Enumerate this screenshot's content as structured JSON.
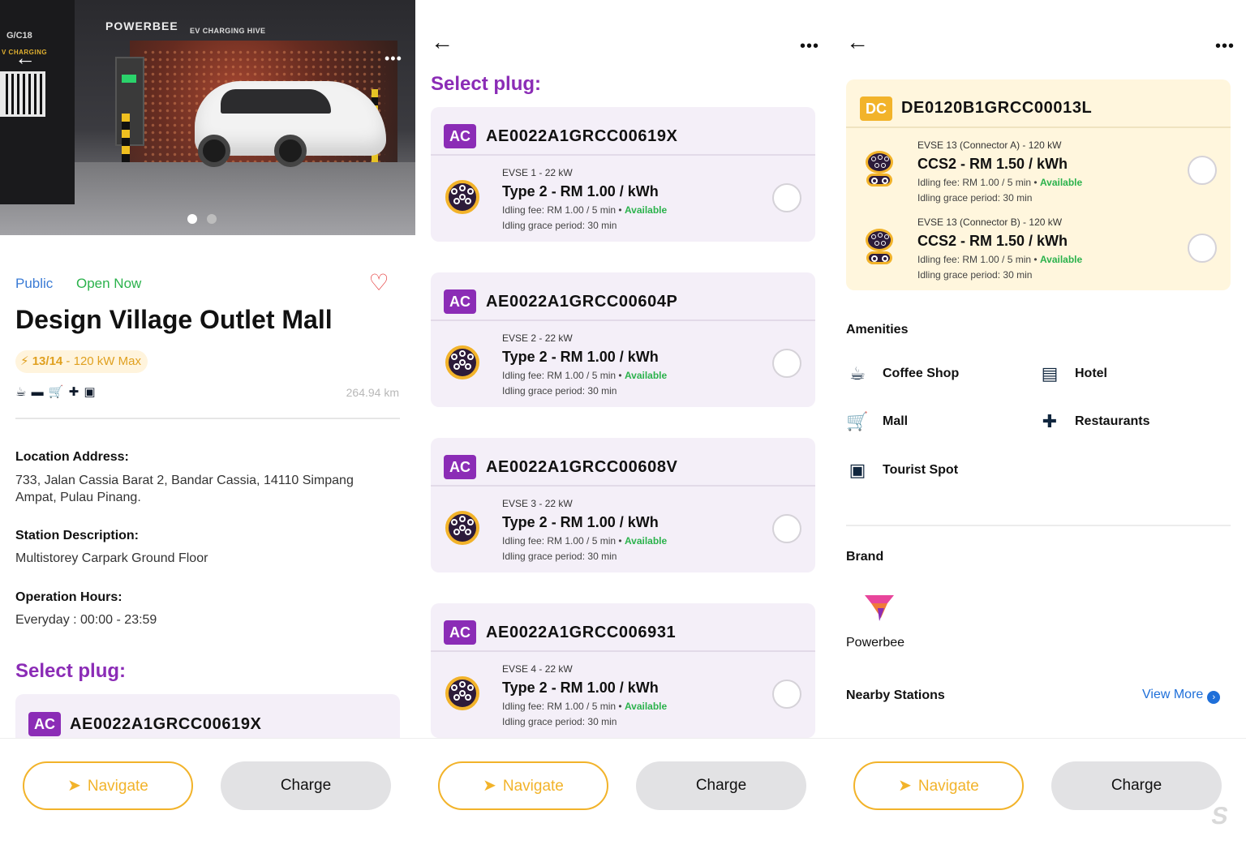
{
  "hero": {
    "brand": "POWERBEE",
    "brand_sub": "EV CHARGING HIVE",
    "kiosk_code": "G/C18",
    "kiosk_sub": "V CHARGING"
  },
  "station": {
    "tag_public": "Public",
    "tag_open": "Open Now",
    "name": "Design Village Outlet Mall",
    "availability": "13/14",
    "max_power": " - 120 kW Max",
    "distance": "264.94 km",
    "address_label": "Location Address:",
    "address": "733, Jalan Cassia Barat 2, Bandar Cassia, 14110 Simpang Ampat, Pulau Pinang.",
    "desc_label": "Station Description:",
    "desc": "Multistorey Carpark Ground Floor",
    "hours_label": "Operation Hours:",
    "hours": "Everyday : 00:00 - 23:59"
  },
  "select_plug_title": "Select plug:",
  "ac_plugs": [
    {
      "badge": "AC",
      "id": "AE0022A1GRCC00619X",
      "evse": "EVSE 1 - 22 kW",
      "type": "Type 2 - RM 1.00 / kWh",
      "idle": "Idling fee: RM 1.00 / 5 min • ",
      "status": "Available",
      "grace": "Idling grace period: 30 min"
    },
    {
      "badge": "AC",
      "id": "AE0022A1GRCC00604P",
      "evse": "EVSE 2 - 22 kW",
      "type": "Type 2 - RM 1.00 / kWh",
      "idle": "Idling fee: RM 1.00 / 5 min • ",
      "status": "Available",
      "grace": "Idling grace period: 30 min"
    },
    {
      "badge": "AC",
      "id": "AE0022A1GRCC00608V",
      "evse": "EVSE 3 - 22 kW",
      "type": "Type 2 - RM 1.00 / kWh",
      "idle": "Idling fee: RM 1.00 / 5 min • ",
      "status": "Available",
      "grace": "Idling grace period: 30 min"
    },
    {
      "badge": "AC",
      "id": "AE0022A1GRCC006931",
      "evse": "EVSE 4 - 22 kW",
      "type": "Type 2 - RM 1.00 / kWh",
      "idle": "Idling fee: RM 1.00 / 5 min • ",
      "status": "Available",
      "grace": "Idling grace period: 30 min"
    }
  ],
  "dc_plug": {
    "badge": "DC",
    "id": "DE0120B1GRCC00013L",
    "connectors": [
      {
        "evse": "EVSE 13 (Connector A) - 120 kW",
        "type": "CCS2 - RM 1.50 / kWh",
        "idle": "Idling fee: RM 1.00 / 5 min • ",
        "status": "Available",
        "grace": "Idling grace period: 30 min"
      },
      {
        "evse": "EVSE 13 (Connector B) - 120 kW",
        "type": "CCS2 - RM 1.50 / kWh",
        "idle": "Idling fee: RM 1.00 / 5 min • ",
        "status": "Available",
        "grace": "Idling grace period: 30 min"
      }
    ]
  },
  "amenities": {
    "title": "Amenities",
    "items": [
      {
        "label": "Coffee Shop",
        "icon": "coffee-icon"
      },
      {
        "label": "Hotel",
        "icon": "bed-icon"
      },
      {
        "label": "Mall",
        "icon": "cart-icon"
      },
      {
        "label": "Restaurants",
        "icon": "utensils-icon"
      },
      {
        "label": "Tourist Spot",
        "icon": "camera-icon"
      }
    ]
  },
  "brand": {
    "title": "Brand",
    "name": "Powerbee"
  },
  "nearby": {
    "title": "Nearby Stations",
    "view_more": "View More"
  },
  "buttons": {
    "navigate": "Navigate",
    "charge": "Charge"
  },
  "colors": {
    "accent_purple": "#8b2cb6",
    "accent_yellow": "#f2b32a",
    "available_green": "#2bb24c",
    "link_blue": "#1e6fd9",
    "tag_blue": "#3a7bd5",
    "tag_green": "#2bb24c"
  }
}
